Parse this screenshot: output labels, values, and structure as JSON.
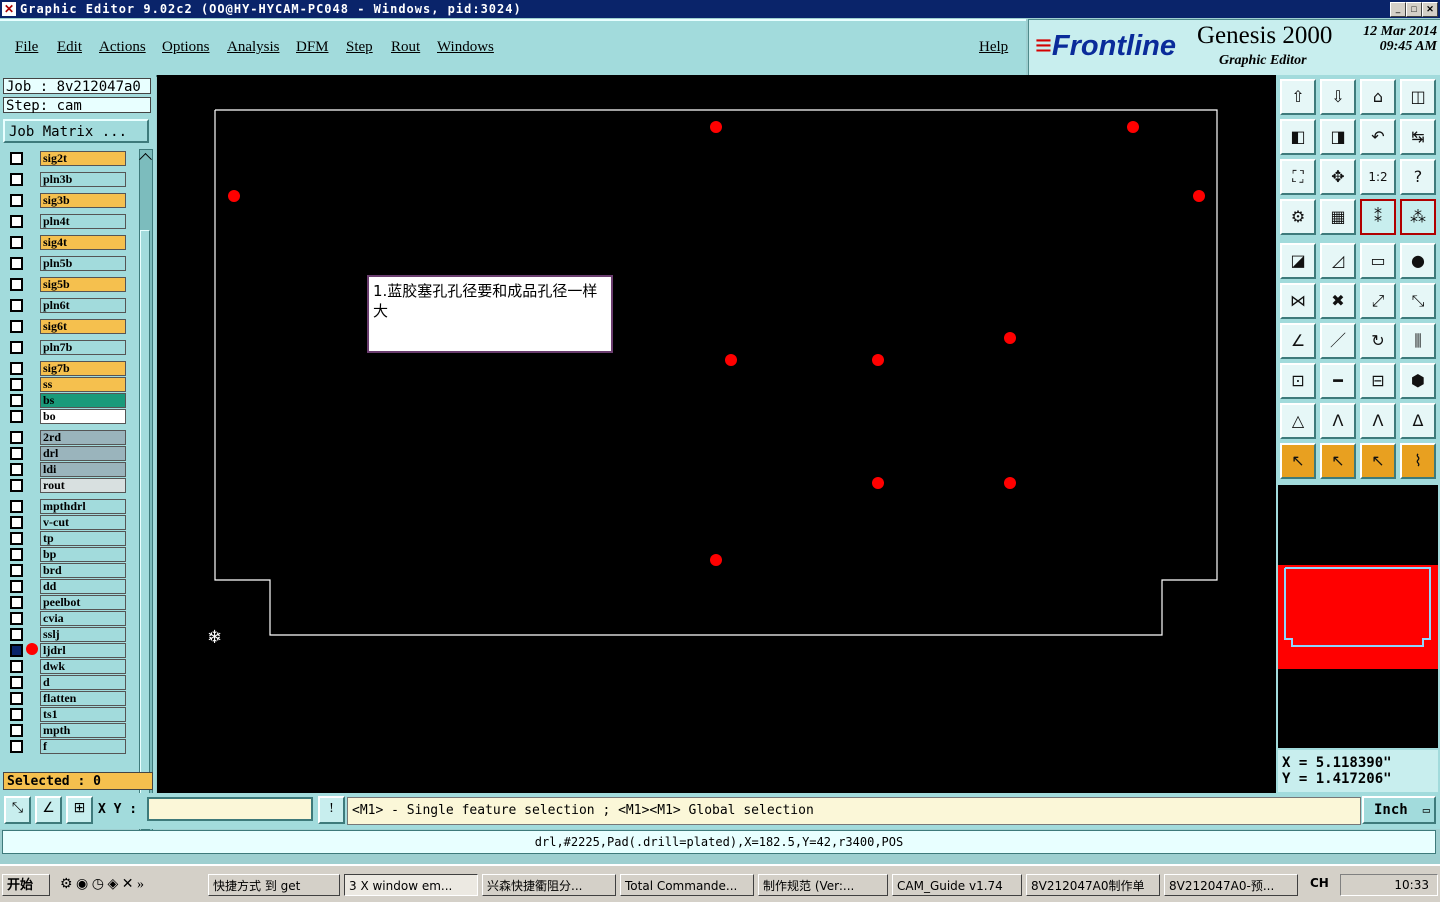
{
  "window": {
    "title": "Graphic Editor 9.02c2  (OO@HY-HYCAM-PC048 - Windows, pid:3024)"
  },
  "menu": {
    "items": [
      "File",
      "Edit",
      "Actions",
      "Options",
      "Analysis",
      "DFM",
      "Step",
      "Rout",
      "Windows"
    ],
    "help": "Help"
  },
  "brand": {
    "logo": "Frontline",
    "product": "Genesis 2000",
    "subtitle": "Graphic Editor",
    "date": "12 Mar 2014",
    "time": "09:45 AM"
  },
  "job": {
    "job_label": "Job : 8v212047a0",
    "step_label": "Step: cam",
    "matrix_button": "Job Matrix ..."
  },
  "layers": [
    {
      "name": "sig2t",
      "color": "#f5c04e"
    },
    {
      "name": "pln3b",
      "color": "#a2dbdc"
    },
    {
      "name": "sig3b",
      "color": "#f5c04e"
    },
    {
      "name": "pln4t",
      "color": "#a2dbdc"
    },
    {
      "name": "sig4t",
      "color": "#f5c04e"
    },
    {
      "name": "pln5b",
      "color": "#a2dbdc"
    },
    {
      "name": "sig5b",
      "color": "#f5c04e"
    },
    {
      "name": "pln6t",
      "color": "#a2dbdc"
    },
    {
      "name": "sig6t",
      "color": "#f5c04e"
    },
    {
      "name": "pln7b",
      "color": "#a2dbdc"
    },
    {
      "name": "sig7b",
      "color": "#f5c04e"
    },
    {
      "name": "ss",
      "color": "#f5c04e"
    },
    {
      "name": "bs",
      "color": "#1a9a7a"
    },
    {
      "name": "bo",
      "color": "#ffffff"
    },
    {
      "name": "2rd",
      "color": "#9ab4bc"
    },
    {
      "name": "drl",
      "color": "#9ab4bc"
    },
    {
      "name": "ldi",
      "color": "#9ab4bc"
    },
    {
      "name": "rout",
      "color": "#d8e0e0"
    },
    {
      "name": "mpthdrl",
      "color": "#a2dbdc"
    },
    {
      "name": "v-cut",
      "color": "#a2dbdc"
    },
    {
      "name": "tp",
      "color": "#a2dbdc"
    },
    {
      "name": "bp",
      "color": "#a2dbdc"
    },
    {
      "name": "brd",
      "color": "#a2dbdc"
    },
    {
      "name": "dd",
      "color": "#a2dbdc"
    },
    {
      "name": "peelbot",
      "color": "#a2dbdc"
    },
    {
      "name": "cvia",
      "color": "#a2dbdc"
    },
    {
      "name": "sslj",
      "color": "#a2dbdc"
    },
    {
      "name": "ljdrl",
      "color": "#a2dbdc",
      "active": true
    },
    {
      "name": "dwk",
      "color": "#a2dbdc"
    },
    {
      "name": "d",
      "color": "#a2dbdc"
    },
    {
      "name": "flatten",
      "color": "#a2dbdc"
    },
    {
      "name": "ts1",
      "color": "#a2dbdc"
    },
    {
      "name": "mpth",
      "color": "#a2dbdc"
    },
    {
      "name": "f",
      "color": "#a2dbdc"
    }
  ],
  "selection": {
    "label": "Selected : 0"
  },
  "canvas": {
    "note": "1.蓝胶塞孔孔径要和成品孔径一样大",
    "pad_color": "#ff0000"
  },
  "toolbar": {
    "icons": [
      "zoom-home-icon",
      "zoom-down-icon",
      "house-icon",
      "split-view-icon",
      "pan-left-icon",
      "pan-right-icon",
      "undo-icon",
      "flip-icon",
      "fit-icon",
      "center-icon",
      "scale-1-2-icon",
      "query-icon",
      "settings-icon",
      "grid-icon",
      "snap-icon",
      "snap-alt-icon",
      "pad-icon",
      "line-icon",
      "ruler-icon",
      "circle-icon",
      "connect-icon",
      "delete-icon",
      "move-icon",
      "copy-icon",
      "angle-icon",
      "slash-icon",
      "arc-icon",
      "ff-icon",
      "node-icon",
      "line-edit-icon",
      "measure-icon",
      "blob-icon",
      "triangle-icon",
      "arch-icon",
      "arch-alt-icon",
      "arch-fill-icon",
      "select-arrow-icon",
      "select-box-icon",
      "select-poly-icon",
      "route-icon"
    ]
  },
  "coords": {
    "x": "X = 5.118390\"",
    "y": "Y = 1.417206\""
  },
  "bottom": {
    "xy_label": "X Y :",
    "message": "<M1> - Single feature selection ; <M1><M1> Global selection",
    "unit": "Inch"
  },
  "status": {
    "feature": "drl,#2225,Pad(.drill=plated),X=182.5,Y=42,r3400,POS"
  },
  "taskbar": {
    "start": "开始",
    "tasks": [
      "快捷方式 到 get",
      "3 X window em...",
      "兴森快捷衢阻分...",
      "Total Commande...",
      "制作规范 (Ver:...",
      "CAM_Guide v1.74",
      "8V212047A0制作单",
      "8V212047A0-预..."
    ],
    "lang": "CH",
    "clock": "10:33"
  }
}
